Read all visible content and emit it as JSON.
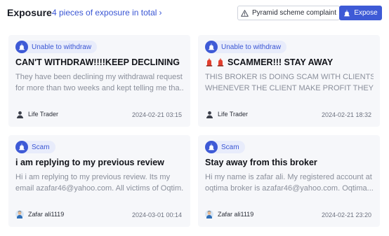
{
  "header": {
    "title": "Exposure",
    "count_text": "4 pieces of exposure in total",
    "complaint_label": "Pyramid scheme complaint",
    "expose_label": "Expose"
  },
  "colors": {
    "accent": "#3e5ad6",
    "tag_bg": "#e8ecfb",
    "card_bg": "#f6f7fa",
    "muted_text": "#8a8f9b",
    "flag_red": "#e2402f"
  },
  "cards": [
    {
      "tag": "Unable to withdraw",
      "title": "CAN'T WITHDRAW!!!!KEEP DECLINING",
      "body_line1": "They have been declining my withdrawal request",
      "body_line2": "for more than two weeks and kept telling me tha...",
      "author": "Life Trader",
      "timestamp": "2024-02-21 03:15",
      "avatar_icon": "user-silhouette-icon"
    },
    {
      "tag": "Unable to withdraw",
      "title": "SCAMMER!!! STAY AWAY",
      "title_icons": [
        "red-flag-icon",
        "red-flag-icon"
      ],
      "body_line1": "THIS BROKER IS DOING SCAM WITH CLIENTS!!!",
      "body_line2": "WHENEVER THE CLIENT MAKE PROFIT THEY WIL...",
      "author": "Life Trader",
      "timestamp": "2024-02-21 18:32",
      "avatar_icon": "user-silhouette-icon"
    },
    {
      "tag": "Scam",
      "title": "i am replying to my previous review",
      "body_line1": "Hi i am replying to my previous review. Its my",
      "body_line2": "email azafar46@yahoo.com. All victims of Oqtim...",
      "author": "Zafar ali1119",
      "timestamp": "2024-03-01 00:14",
      "avatar_icon": "person-avatar-icon"
    },
    {
      "tag": "Scam",
      "title": "Stay away from this broker",
      "body_line1": "Hi my name is zafar ali. My registered account at",
      "body_line2": "oqtima broker is azafar46@yahoo.com. Oqtima...",
      "author": "Zafar ali1119",
      "timestamp": "2024-02-21 23:20",
      "avatar_icon": "person-avatar-icon"
    }
  ]
}
